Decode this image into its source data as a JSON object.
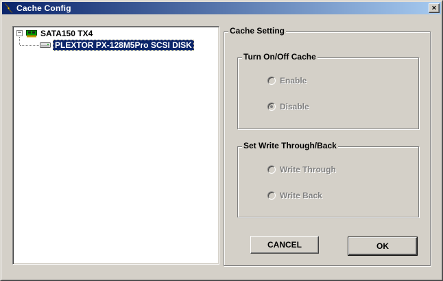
{
  "window": {
    "title": "Cache Config",
    "close_label": "×"
  },
  "tree": {
    "expander": "−",
    "root": {
      "label": "SATA150 TX4",
      "icon": "controller-card-icon"
    },
    "child": {
      "label": "PLEXTOR PX-128M5Pro SCSI DISK",
      "icon": "disk-drive-icon",
      "selected": true
    }
  },
  "cache_setting": {
    "title": "Cache Setting",
    "cache_toggle": {
      "title": "Turn On/Off Cache",
      "options": [
        {
          "label": "Enable",
          "checked": false,
          "enabled": false
        },
        {
          "label": "Disable",
          "checked": true,
          "enabled": false
        }
      ]
    },
    "write_mode": {
      "title": "Set Write Through/Back",
      "options": [
        {
          "label": "Write Through",
          "checked": false,
          "enabled": false
        },
        {
          "label": "Write Back",
          "checked": false,
          "enabled": false
        }
      ]
    }
  },
  "buttons": {
    "cancel": "CANCEL",
    "ok": "OK"
  },
  "colors": {
    "titlebar_start": "#0a246a",
    "titlebar_end": "#a6caf0",
    "face": "#d4d0c8",
    "selection": "#0a246a"
  }
}
